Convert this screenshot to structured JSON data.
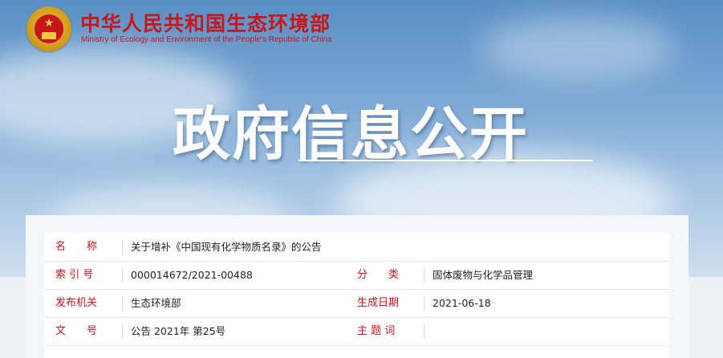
{
  "header": {
    "org_name_cn": "中华人民共和国生态环境部",
    "org_name_en": "Ministry of Ecology and Environment of the People's Republic of China",
    "emblem": "national-emblem-icon"
  },
  "banner": {
    "headline": "政府信息公开"
  },
  "info": {
    "name_label": "名　　称",
    "name_value": "关于增补《中国现有化学物质名录》的公告",
    "index_label": "索 引 号",
    "index_value": "000014672/2021-00488",
    "category_label": "分　　类",
    "category_value": "固体废物与化学品管理",
    "issuer_label": "发布机关",
    "issuer_value": "生态环境部",
    "date_label": "生成日期",
    "date_value": "2021-06-18",
    "doc_no_label": "文　　号",
    "doc_no_value": "公告 2021年 第25号",
    "keywords_label": "主 题 词",
    "keywords_value": ""
  },
  "colors": {
    "brand_red": "#c8161d",
    "sky_blue": "#5a8fc4"
  }
}
